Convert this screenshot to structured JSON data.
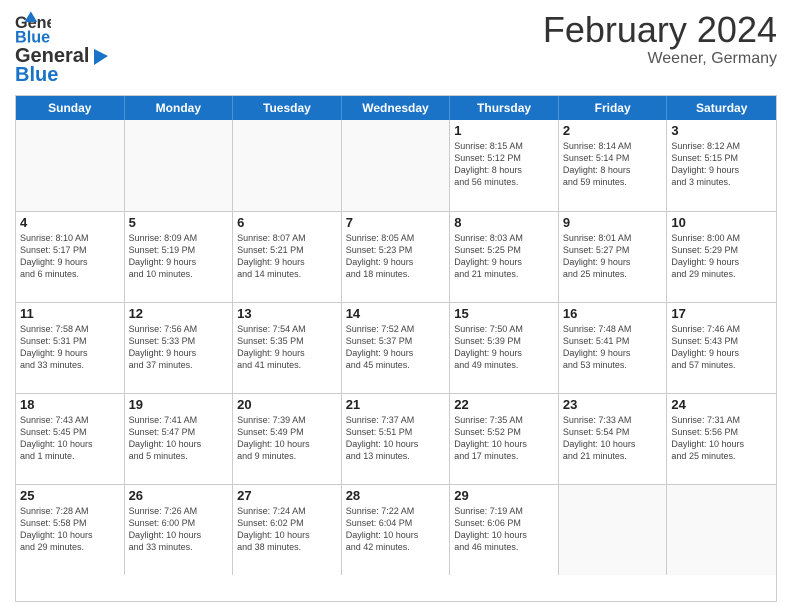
{
  "header": {
    "logo_general": "General",
    "logo_blue": "Blue",
    "month_title": "February 2024",
    "location": "Weener, Germany"
  },
  "days_of_week": [
    "Sunday",
    "Monday",
    "Tuesday",
    "Wednesday",
    "Thursday",
    "Friday",
    "Saturday"
  ],
  "weeks": [
    [
      {
        "day": "",
        "info": ""
      },
      {
        "day": "",
        "info": ""
      },
      {
        "day": "",
        "info": ""
      },
      {
        "day": "",
        "info": ""
      },
      {
        "day": "1",
        "info": "Sunrise: 8:15 AM\nSunset: 5:12 PM\nDaylight: 8 hours\nand 56 minutes."
      },
      {
        "day": "2",
        "info": "Sunrise: 8:14 AM\nSunset: 5:14 PM\nDaylight: 8 hours\nand 59 minutes."
      },
      {
        "day": "3",
        "info": "Sunrise: 8:12 AM\nSunset: 5:15 PM\nDaylight: 9 hours\nand 3 minutes."
      }
    ],
    [
      {
        "day": "4",
        "info": "Sunrise: 8:10 AM\nSunset: 5:17 PM\nDaylight: 9 hours\nand 6 minutes."
      },
      {
        "day": "5",
        "info": "Sunrise: 8:09 AM\nSunset: 5:19 PM\nDaylight: 9 hours\nand 10 minutes."
      },
      {
        "day": "6",
        "info": "Sunrise: 8:07 AM\nSunset: 5:21 PM\nDaylight: 9 hours\nand 14 minutes."
      },
      {
        "day": "7",
        "info": "Sunrise: 8:05 AM\nSunset: 5:23 PM\nDaylight: 9 hours\nand 18 minutes."
      },
      {
        "day": "8",
        "info": "Sunrise: 8:03 AM\nSunset: 5:25 PM\nDaylight: 9 hours\nand 21 minutes."
      },
      {
        "day": "9",
        "info": "Sunrise: 8:01 AM\nSunset: 5:27 PM\nDaylight: 9 hours\nand 25 minutes."
      },
      {
        "day": "10",
        "info": "Sunrise: 8:00 AM\nSunset: 5:29 PM\nDaylight: 9 hours\nand 29 minutes."
      }
    ],
    [
      {
        "day": "11",
        "info": "Sunrise: 7:58 AM\nSunset: 5:31 PM\nDaylight: 9 hours\nand 33 minutes."
      },
      {
        "day": "12",
        "info": "Sunrise: 7:56 AM\nSunset: 5:33 PM\nDaylight: 9 hours\nand 37 minutes."
      },
      {
        "day": "13",
        "info": "Sunrise: 7:54 AM\nSunset: 5:35 PM\nDaylight: 9 hours\nand 41 minutes."
      },
      {
        "day": "14",
        "info": "Sunrise: 7:52 AM\nSunset: 5:37 PM\nDaylight: 9 hours\nand 45 minutes."
      },
      {
        "day": "15",
        "info": "Sunrise: 7:50 AM\nSunset: 5:39 PM\nDaylight: 9 hours\nand 49 minutes."
      },
      {
        "day": "16",
        "info": "Sunrise: 7:48 AM\nSunset: 5:41 PM\nDaylight: 9 hours\nand 53 minutes."
      },
      {
        "day": "17",
        "info": "Sunrise: 7:46 AM\nSunset: 5:43 PM\nDaylight: 9 hours\nand 57 minutes."
      }
    ],
    [
      {
        "day": "18",
        "info": "Sunrise: 7:43 AM\nSunset: 5:45 PM\nDaylight: 10 hours\nand 1 minute."
      },
      {
        "day": "19",
        "info": "Sunrise: 7:41 AM\nSunset: 5:47 PM\nDaylight: 10 hours\nand 5 minutes."
      },
      {
        "day": "20",
        "info": "Sunrise: 7:39 AM\nSunset: 5:49 PM\nDaylight: 10 hours\nand 9 minutes."
      },
      {
        "day": "21",
        "info": "Sunrise: 7:37 AM\nSunset: 5:51 PM\nDaylight: 10 hours\nand 13 minutes."
      },
      {
        "day": "22",
        "info": "Sunrise: 7:35 AM\nSunset: 5:52 PM\nDaylight: 10 hours\nand 17 minutes."
      },
      {
        "day": "23",
        "info": "Sunrise: 7:33 AM\nSunset: 5:54 PM\nDaylight: 10 hours\nand 21 minutes."
      },
      {
        "day": "24",
        "info": "Sunrise: 7:31 AM\nSunset: 5:56 PM\nDaylight: 10 hours\nand 25 minutes."
      }
    ],
    [
      {
        "day": "25",
        "info": "Sunrise: 7:28 AM\nSunset: 5:58 PM\nDaylight: 10 hours\nand 29 minutes."
      },
      {
        "day": "26",
        "info": "Sunrise: 7:26 AM\nSunset: 6:00 PM\nDaylight: 10 hours\nand 33 minutes."
      },
      {
        "day": "27",
        "info": "Sunrise: 7:24 AM\nSunset: 6:02 PM\nDaylight: 10 hours\nand 38 minutes."
      },
      {
        "day": "28",
        "info": "Sunrise: 7:22 AM\nSunset: 6:04 PM\nDaylight: 10 hours\nand 42 minutes."
      },
      {
        "day": "29",
        "info": "Sunrise: 7:19 AM\nSunset: 6:06 PM\nDaylight: 10 hours\nand 46 minutes."
      },
      {
        "day": "",
        "info": ""
      },
      {
        "day": "",
        "info": ""
      }
    ]
  ]
}
